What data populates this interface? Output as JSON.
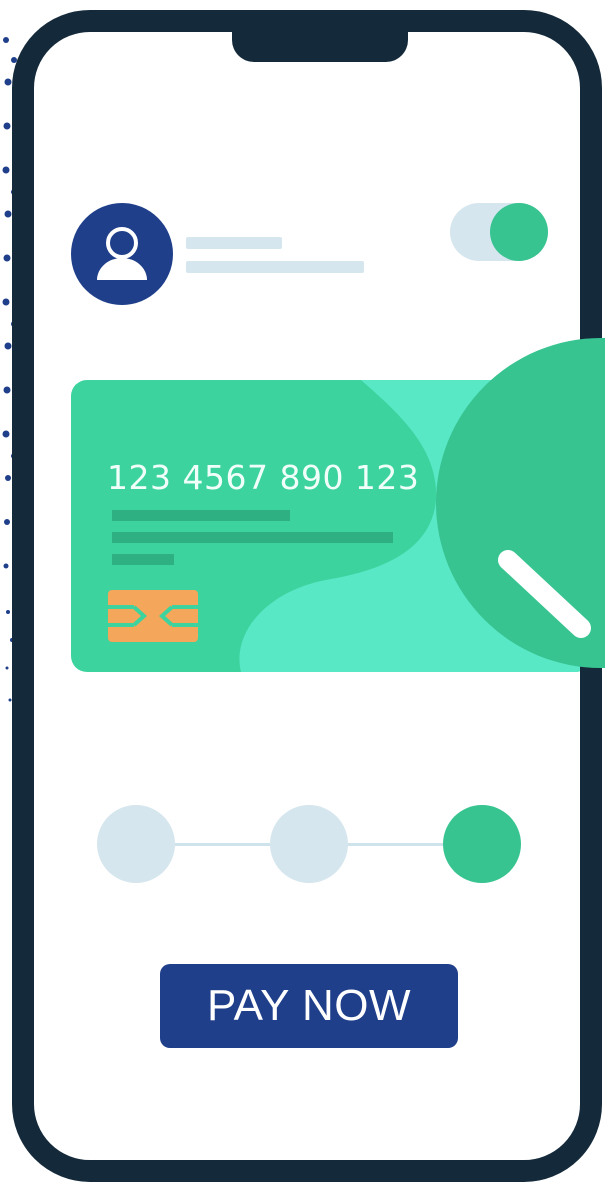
{
  "card": {
    "number": "123 4567 890 123"
  },
  "toggle": {
    "state": "on"
  },
  "stepper": {
    "total_steps": 3,
    "active_step": 3
  },
  "actions": {
    "pay_label": "PAY NOW"
  },
  "colors": {
    "phone_frame": "#142a3b",
    "brand_blue": "#1f3f8a",
    "accent_green": "#37c491",
    "card_green": "#3dd39e",
    "card_light_green": "#58e8c6",
    "chip_orange": "#f4a65a",
    "inactive_gray": "#d5e6ee"
  },
  "icons": {
    "avatar": "user-icon",
    "chip": "card-chip-icon",
    "badge": "checkmark-icon"
  }
}
